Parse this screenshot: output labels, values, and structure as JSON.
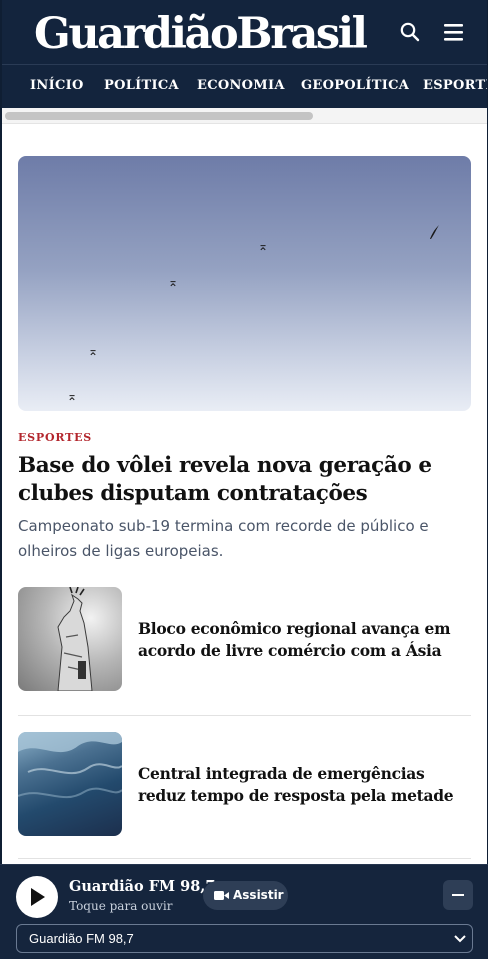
{
  "header": {
    "logo": "GuardiãoBrasil",
    "search_icon": "search-icon",
    "menu_icon": "hamburger-menu-icon"
  },
  "nav": {
    "items": [
      {
        "label": "INÍCIO"
      },
      {
        "label": "POLÍTICA"
      },
      {
        "label": "ECONOMIA"
      },
      {
        "label": "GEOPOLÍTICA"
      },
      {
        "label": "ESPORTES"
      }
    ]
  },
  "hero": {
    "category": "ESPORTES",
    "title": "Base do vôlei revela nova geração e clubes disputam contratações",
    "subtitle": "Campeonato sub-19 termina com recorde de público e olheiros de ligas europeias.",
    "image_subject": "birds-in-sky"
  },
  "stories": [
    {
      "title": "Bloco econômico regional avança em acordo de livre comércio com a Ásia",
      "image_subject": "statue-of-liberty"
    },
    {
      "title": "Central integrada de emergências reduz tempo de resposta pela metade",
      "image_subject": "ocean-water"
    }
  ],
  "player": {
    "station": "Guardião FM 98,7",
    "subtitle": "Toque para ouvir",
    "watch_label": "Assistir",
    "select_value": "Guardião FM 98,7",
    "play_icon": "play-icon",
    "video_icon": "video-camera-icon",
    "collapse_icon": "minus-icon"
  },
  "colors": {
    "header_bg": "#13243d",
    "category_red": "#b3262d",
    "text_dark": "#111111"
  }
}
